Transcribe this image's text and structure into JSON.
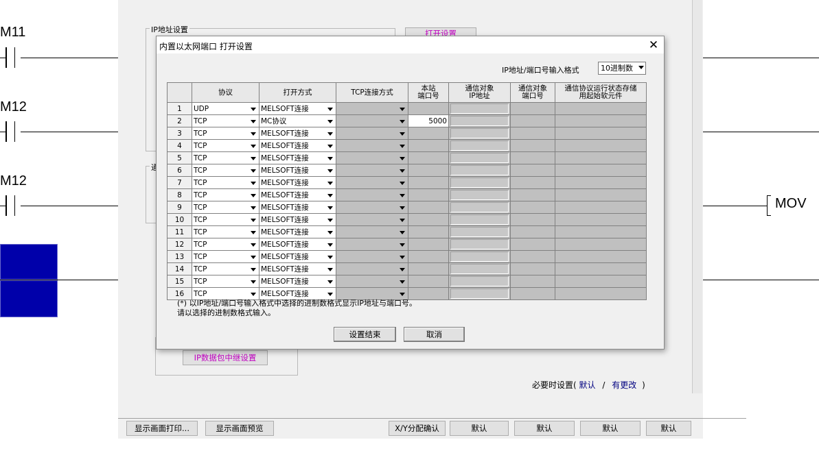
{
  "ladder": {
    "labels": [
      "M11",
      "M12",
      "M12"
    ],
    "instruction": "MOV"
  },
  "parent": {
    "group_ip": "IP地址设置",
    "group_comm": "通",
    "group_ip_relay": "IP",
    "btn_open_settings": "打开设置",
    "btn_ip_relay": "IP数据包中继设置",
    "status_prefix": "必要时设置(",
    "status_default": "默认",
    "status_sep": "/",
    "status_changed": "有更改",
    "status_suffix": ")",
    "bottom_buttons": {
      "print": "显示画面打印...",
      "preview": "显示画面预览",
      "xy_check": "X/Y分配确认",
      "default1": "默认",
      "default2": "默认",
      "default3": "默认",
      "default4": "默认"
    }
  },
  "dialog": {
    "title": "内置以太网端口 打开设置",
    "close_glyph": "✕",
    "format_label": "IP地址/端口号输入格式",
    "format_value": "10进制数",
    "columns": {
      "c1": "协议",
      "c2": "打开方式",
      "c3": "TCP连接方式",
      "c4a": "本站",
      "c4b": "端口号",
      "c5a": "通信对象",
      "c5b": "IP地址",
      "c6a": "通信对象",
      "c6b": "端口号",
      "c7a": "通信协议运行状态存储",
      "c7b": "用起始软元件"
    },
    "rows": [
      {
        "no": "1",
        "protocol": "UDP",
        "open": "MELSOFT连接",
        "port": ""
      },
      {
        "no": "2",
        "protocol": "TCP",
        "open": "MC协议",
        "port": "5000"
      },
      {
        "no": "3",
        "protocol": "TCP",
        "open": "MELSOFT连接",
        "port": ""
      },
      {
        "no": "4",
        "protocol": "TCP",
        "open": "MELSOFT连接",
        "port": ""
      },
      {
        "no": "5",
        "protocol": "TCP",
        "open": "MELSOFT连接",
        "port": ""
      },
      {
        "no": "6",
        "protocol": "TCP",
        "open": "MELSOFT连接",
        "port": ""
      },
      {
        "no": "7",
        "protocol": "TCP",
        "open": "MELSOFT连接",
        "port": ""
      },
      {
        "no": "8",
        "protocol": "TCP",
        "open": "MELSOFT连接",
        "port": ""
      },
      {
        "no": "9",
        "protocol": "TCP",
        "open": "MELSOFT连接",
        "port": ""
      },
      {
        "no": "10",
        "protocol": "TCP",
        "open": "MELSOFT连接",
        "port": ""
      },
      {
        "no": "11",
        "protocol": "TCP",
        "open": "MELSOFT连接",
        "port": ""
      },
      {
        "no": "12",
        "protocol": "TCP",
        "open": "MELSOFT连接",
        "port": ""
      },
      {
        "no": "13",
        "protocol": "TCP",
        "open": "MELSOFT连接",
        "port": ""
      },
      {
        "no": "14",
        "protocol": "TCP",
        "open": "MELSOFT连接",
        "port": ""
      },
      {
        "no": "15",
        "protocol": "TCP",
        "open": "MELSOFT连接",
        "port": ""
      },
      {
        "no": "16",
        "protocol": "TCP",
        "open": "MELSOFT连接",
        "port": ""
      }
    ],
    "note_line1": "(*) 以IP地址/端口号输入格式中选择的进制数格式显示IP地址与端口号。",
    "note_line2": "请以选择的进制数格式输入。",
    "btn_ok": "设置结束",
    "btn_cancel": "取消"
  }
}
